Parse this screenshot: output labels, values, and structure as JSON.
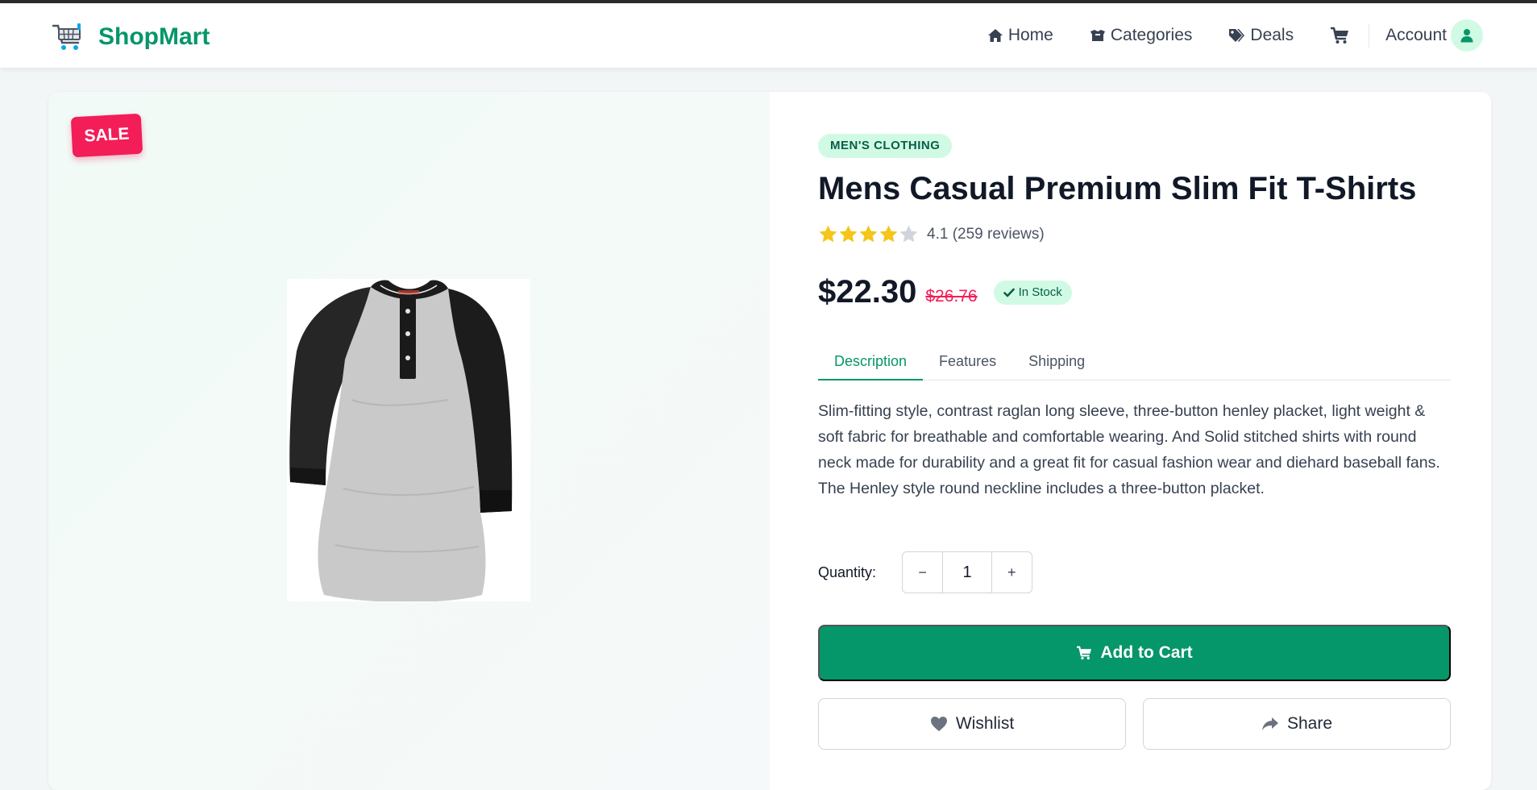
{
  "brand": {
    "name": "ShopMart",
    "icon": "shopping-cart-logo-icon",
    "color": "#059669"
  },
  "nav": {
    "items": [
      {
        "label": "Home",
        "icon": "home-icon"
      },
      {
        "label": "Categories",
        "icon": "box-icon"
      },
      {
        "label": "Deals",
        "icon": "tags-icon"
      }
    ],
    "cart_icon": "cart-icon",
    "account_label": "Account",
    "account_icon": "user-icon"
  },
  "product": {
    "sale_badge": "SALE",
    "category": "MEN'S CLOTHING",
    "title": "Mens Casual Premium Slim Fit T-Shirts",
    "rating": {
      "value": 4.1,
      "text": "4.1 (259 reviews)",
      "stars_filled": 4,
      "stars_total": 5
    },
    "price": "$22.30",
    "old_price": "$26.76",
    "stock": "In Stock",
    "tabs": [
      "Description",
      "Features",
      "Shipping"
    ],
    "active_tab": "Description",
    "description": "Slim-fitting style, contrast raglan long sleeve, three-button henley placket, light weight & soft fabric for breathable and comfortable wearing. And Solid stitched shirts with round neck made for durability and a great fit for casual fashion wear and diehard baseball fans. The Henley style round neckline includes a three-button placket.",
    "quantity_label": "Quantity:",
    "quantity": "1",
    "minus": "−",
    "plus": "+",
    "add_to_cart": "Add to Cart",
    "wishlist": "Wishlist",
    "share": "Share"
  },
  "colors": {
    "accent": "#059669",
    "sale": "#f31d57",
    "badge_bg": "#d1fae5",
    "star": "#f5c518"
  }
}
